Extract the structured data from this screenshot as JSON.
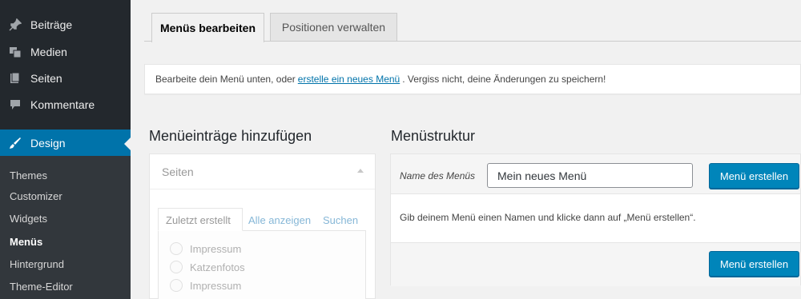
{
  "sidebar": {
    "items": [
      {
        "label": "Beiträge",
        "icon": "pin-icon"
      },
      {
        "label": "Medien",
        "icon": "media-icon"
      },
      {
        "label": "Seiten",
        "icon": "pages-icon"
      },
      {
        "label": "Kommentare",
        "icon": "comment-icon"
      },
      {
        "label": "Design",
        "icon": "brush-icon",
        "active": true
      }
    ],
    "submenu": [
      {
        "label": "Themes"
      },
      {
        "label": "Customizer"
      },
      {
        "label": "Widgets"
      },
      {
        "label": "Menüs",
        "current": true
      },
      {
        "label": "Hintergrund"
      },
      {
        "label": "Theme-Editor"
      }
    ],
    "colors": {
      "background": "#23282d",
      "submenu": "#32373c",
      "active": "#0073aa"
    }
  },
  "tabs": {
    "edit": "Menüs bearbeiten",
    "locations": "Positionen verwalten"
  },
  "notice": {
    "before": "Bearbeite dein Menü unten, oder",
    "link": "erstelle ein neues Menü",
    "after": ". Vergiss nicht, deine Änderungen zu speichern!"
  },
  "add_items": {
    "heading": "Menüeinträge hinzufügen",
    "section_title": "Seiten",
    "inner_tabs": {
      "recent": "Zuletzt erstellt",
      "all": "Alle anzeigen",
      "search": "Suchen"
    },
    "pages": [
      "Impressum",
      "Katzenfotos",
      "Impressum"
    ]
  },
  "menu_structure": {
    "heading": "Menüstruktur",
    "name_label": "Name des Menüs",
    "name_value": "Mein neues Menü",
    "create_button": "Menü erstellen",
    "body_text": "Gib deinem Menü einen Namen und klicke dann auf „Menü erstellen“.",
    "create_button_bottom": "Menü erstellen"
  },
  "colors": {
    "primary_button": "#0085ba",
    "link": "#0073aa"
  }
}
